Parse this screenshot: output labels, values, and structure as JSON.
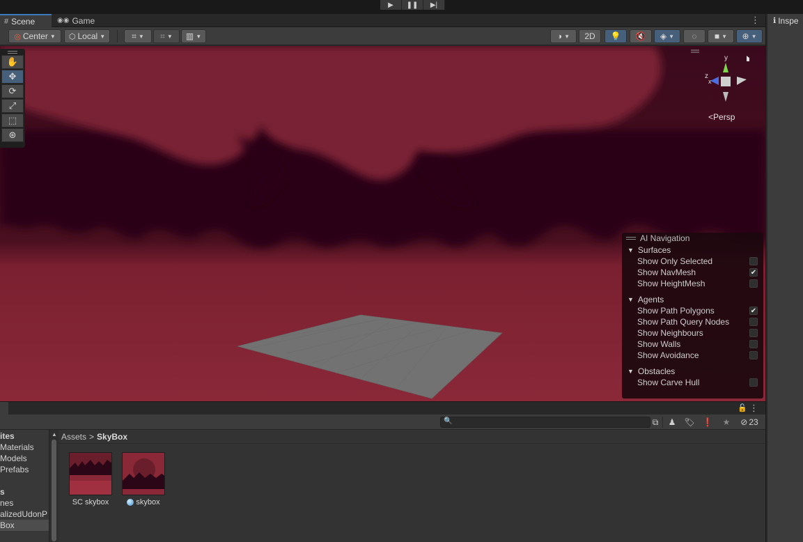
{
  "playbar": {
    "play": "▶",
    "pause": "❚❚",
    "step": "▶|"
  },
  "scene": {
    "tabs": [
      {
        "label": "Scene",
        "icon": "grid-icon"
      },
      {
        "label": "Game",
        "icon": "gamepad-icon"
      }
    ],
    "toolbar": {
      "pivot": "Center",
      "space": "Local",
      "mode_2d": "2D"
    },
    "tools": [
      "hand-tool",
      "move-tool",
      "rotate-tool",
      "scale-tool",
      "rect-tool",
      "transform-tool"
    ],
    "gizmo": {
      "y": "y",
      "x": "x",
      "z": "z",
      "persp": "Persp"
    },
    "ai_nav": {
      "title": "AI Navigation",
      "sections": [
        {
          "name": "Surfaces",
          "items": [
            {
              "label": "Show Only Selected",
              "checked": false
            },
            {
              "label": "Show NavMesh",
              "checked": true
            },
            {
              "label": "Show HeightMesh",
              "checked": false
            }
          ]
        },
        {
          "name": "Agents",
          "items": [
            {
              "label": "Show Path Polygons",
              "checked": true
            },
            {
              "label": "Show Path Query Nodes",
              "checked": false
            },
            {
              "label": "Show Neighbours",
              "checked": false
            },
            {
              "label": "Show Walls",
              "checked": false
            },
            {
              "label": "Show Avoidance",
              "checked": false
            }
          ]
        },
        {
          "name": "Obstacles",
          "items": [
            {
              "label": "Show Carve Hull",
              "checked": false
            }
          ]
        }
      ]
    }
  },
  "inspector": {
    "tab_label": "Inspe"
  },
  "project": {
    "hidden_count": "23",
    "tree": [
      {
        "label": "ites",
        "bold": true
      },
      {
        "label": "Materials"
      },
      {
        "label": "Models"
      },
      {
        "label": "Prefabs"
      },
      {
        "label": ""
      },
      {
        "label": "s",
        "bold": true
      },
      {
        "label": "nes"
      },
      {
        "label": "alizedUdonP"
      },
      {
        "label": "Box",
        "selected": true
      }
    ],
    "breadcrumb": {
      "root": "Assets",
      "sep": ">",
      "current": "SkyBox"
    },
    "assets": [
      {
        "name": "SC skybox",
        "icon": "texture-thumbnail"
      },
      {
        "name": "skybox",
        "icon": "material-icon"
      }
    ]
  },
  "colors": {
    "sky_dark": "#2a0616",
    "sky_light": "#8a2a3a",
    "accent": "#46607c",
    "tab_accent": "#3a79bb"
  }
}
